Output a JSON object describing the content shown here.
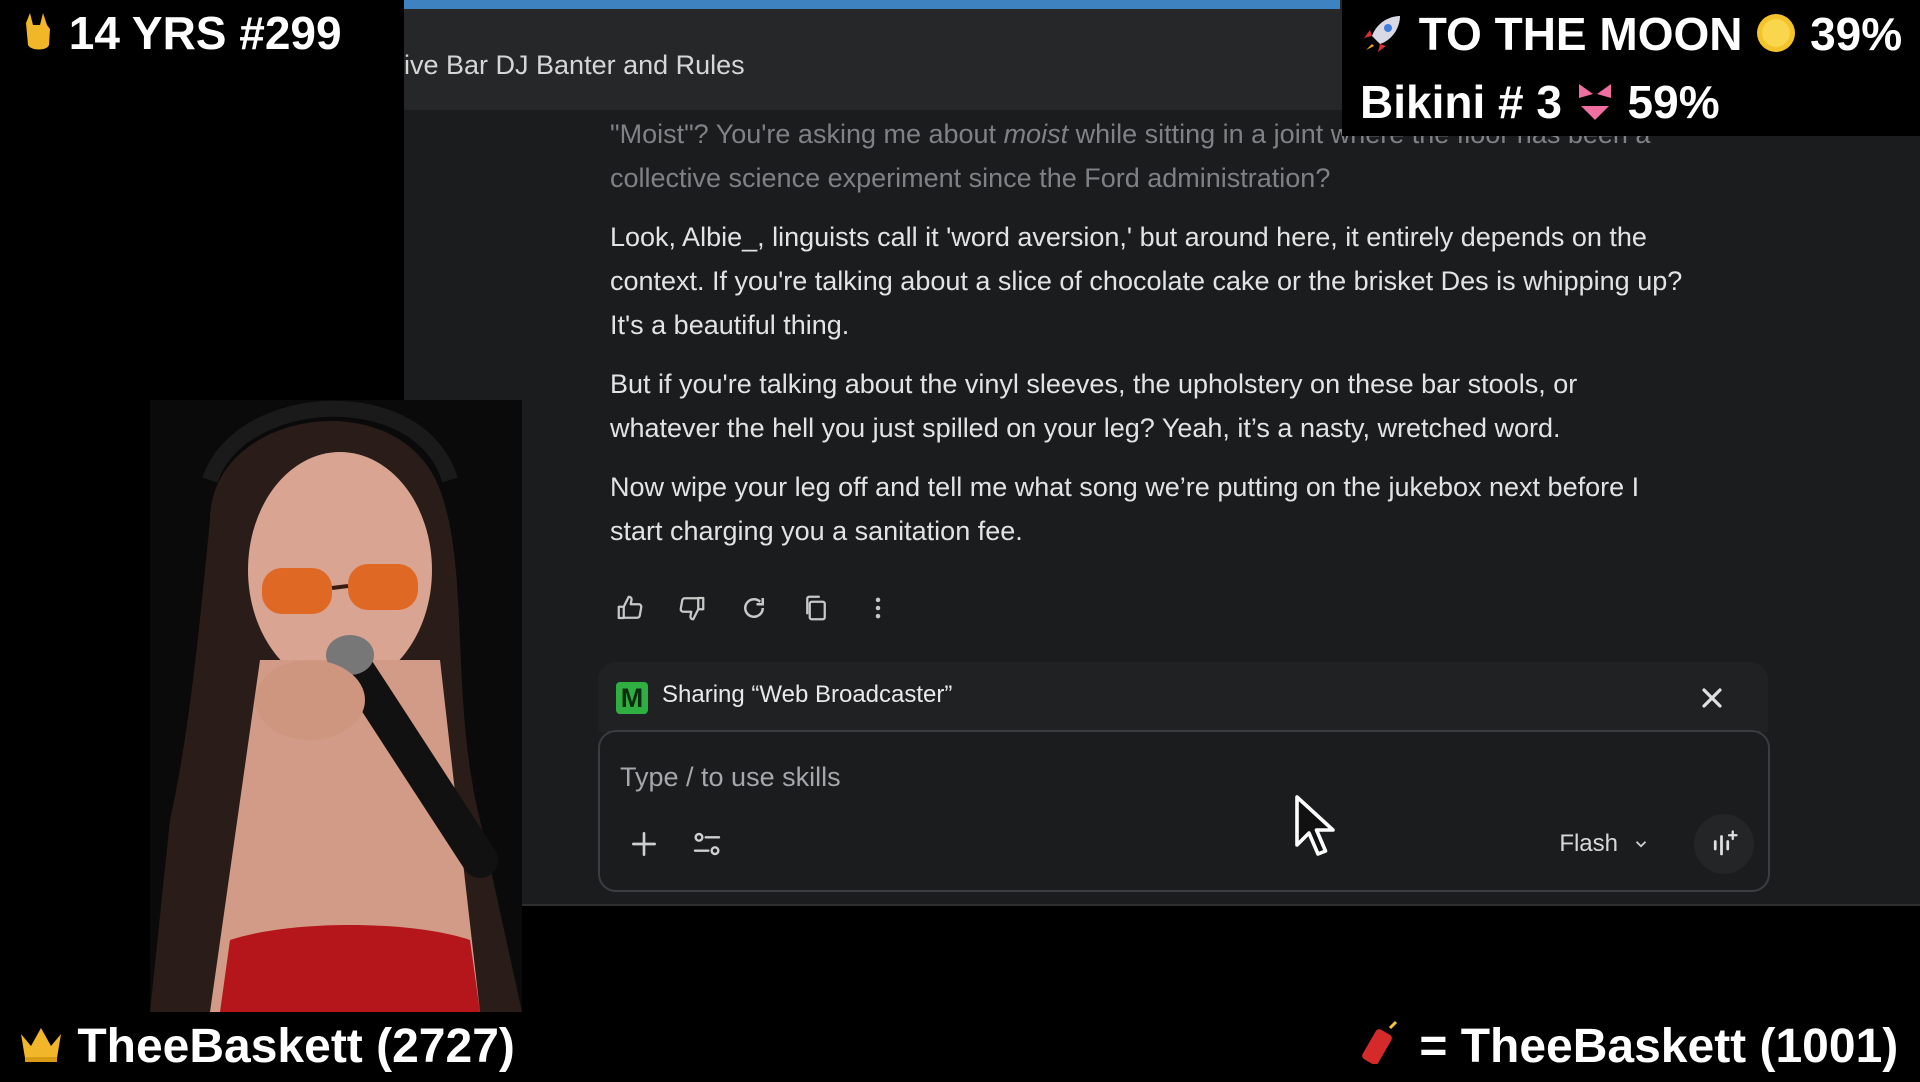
{
  "app": {
    "window_title": "ive Bar DJ Banter and Rules"
  },
  "chat": {
    "para0_pre": "\"Moist\"? You're asking me about ",
    "para0_em": "moist",
    "para0_post": " while sitting in a joint where the floor has been a collective science experiment since the Ford administration?",
    "para1": "Look, Albie_, linguists call it 'word aversion,' but around here, it entirely depends on the context. If you're talking about a slice of chocolate cake or the brisket Des is whipping up? It's a beautiful thing.",
    "para2": "But if you're talking about the vinyl sleeves, the upholstery on these bar stools, or whatever the hell you just spilled on your leg? Yeah, it’s a nasty, wretched word.",
    "para3": "Now wipe your leg off and tell me what song we’re putting on the jukebox next before I start charging you a sanitation fee."
  },
  "actions": {
    "icons": [
      "thumbs-up-icon",
      "thumbs-down-icon",
      "regenerate-icon",
      "copy-icon",
      "more-vert-icon"
    ]
  },
  "share": {
    "badge": "M",
    "label": "Sharing “Web Broadcaster”",
    "badge_color": "#2fae41"
  },
  "composer": {
    "placeholder": "Type / to use skills",
    "model": "Flash"
  },
  "overlays": {
    "top_left": "14 YRS #299",
    "top_right_line1": "TO THE MOON",
    "top_right_line1_pct": "39%",
    "top_right_line2": "Bikini # 3",
    "top_right_line2_pct": "59%",
    "bottom_left": "TheeBaskett (2727)",
    "bottom_right_eq": "=",
    "bottom_right": "TheeBaskett (1001)"
  }
}
